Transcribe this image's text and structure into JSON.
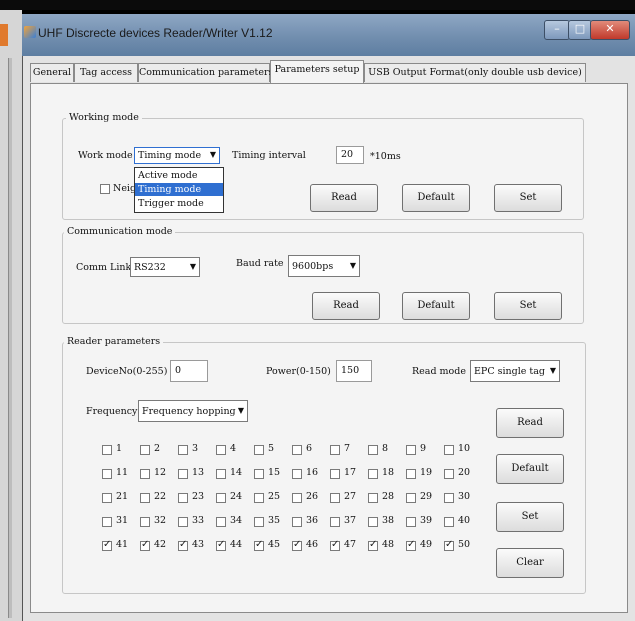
{
  "window": {
    "title": "UHF Discrecte devices Reader/Writer V1.12",
    "controls": {
      "minimize": "–",
      "maximize": "□",
      "close": "✕"
    }
  },
  "tabs": [
    {
      "label": "General",
      "active": false
    },
    {
      "label": "Tag access",
      "active": false
    },
    {
      "label": "Communication parameters",
      "active": false
    },
    {
      "label": "Parameters setup",
      "active": true
    },
    {
      "label": "USB Output Format(only double usb device)",
      "active": false
    }
  ],
  "working_mode": {
    "title": "Working mode",
    "work_mode_label": "Work mode",
    "work_mode_value": "Timing mode",
    "options": [
      "Active mode",
      "Timing mode",
      "Trigger mode"
    ],
    "selected_option_index": 1,
    "timing_interval_label": "Timing interval",
    "timing_interval_value": "20",
    "timing_unit": "*10ms",
    "neighbor_checkbox_visible_label": "Neig",
    "neighbor_checkbox_suffix": ")",
    "buttons": {
      "read": "Read",
      "default": "Default",
      "set": "Set"
    }
  },
  "communication_mode": {
    "title": "Communication mode",
    "comm_link_label": "Comm Link",
    "comm_link_value": "RS232",
    "baud_rate_label": "Baud rate",
    "baud_rate_value": "9600bps",
    "buttons": {
      "read": "Read",
      "default": "Default",
      "set": "Set"
    }
  },
  "reader_parameters": {
    "title": "Reader parameters",
    "device_no_label": "DeviceNo(0-255)",
    "device_no_value": "0",
    "power_label": "Power(0-150)",
    "power_value": "150",
    "read_mode_label": "Read mode",
    "read_mode_value": "EPC single tag",
    "frequency_label": "Frequency",
    "frequency_value": "Frequency hopping",
    "buttons": {
      "read": "Read",
      "default": "Default",
      "set": "Set",
      "clear": "Clear"
    },
    "frequencies": [
      {
        "label": "1",
        "checked": false
      },
      {
        "label": "2",
        "checked": false
      },
      {
        "label": "3",
        "checked": false
      },
      {
        "label": "4",
        "checked": false
      },
      {
        "label": "5",
        "checked": false
      },
      {
        "label": "6",
        "checked": false
      },
      {
        "label": "7",
        "checked": false
      },
      {
        "label": "8",
        "checked": false
      },
      {
        "label": "9",
        "checked": false
      },
      {
        "label": "10",
        "checked": false
      },
      {
        "label": "11",
        "checked": false
      },
      {
        "label": "12",
        "checked": false
      },
      {
        "label": "13",
        "checked": false
      },
      {
        "label": "14",
        "checked": false
      },
      {
        "label": "15",
        "checked": false
      },
      {
        "label": "16",
        "checked": false
      },
      {
        "label": "17",
        "checked": false
      },
      {
        "label": "18",
        "checked": false
      },
      {
        "label": "19",
        "checked": false
      },
      {
        "label": "20",
        "checked": false
      },
      {
        "label": "21",
        "checked": false
      },
      {
        "label": "22",
        "checked": false
      },
      {
        "label": "23",
        "checked": false
      },
      {
        "label": "24",
        "checked": false
      },
      {
        "label": "25",
        "checked": false
      },
      {
        "label": "26",
        "checked": false
      },
      {
        "label": "27",
        "checked": false
      },
      {
        "label": "28",
        "checked": false
      },
      {
        "label": "29",
        "checked": false
      },
      {
        "label": "30",
        "checked": false
      },
      {
        "label": "31",
        "checked": false
      },
      {
        "label": "32",
        "checked": false
      },
      {
        "label": "33",
        "checked": false
      },
      {
        "label": "34",
        "checked": false
      },
      {
        "label": "35",
        "checked": false
      },
      {
        "label": "36",
        "checked": false
      },
      {
        "label": "37",
        "checked": false
      },
      {
        "label": "38",
        "checked": false
      },
      {
        "label": "39",
        "checked": false
      },
      {
        "label": "40",
        "checked": false
      },
      {
        "label": "41",
        "checked": true
      },
      {
        "label": "42",
        "checked": true
      },
      {
        "label": "43",
        "checked": true
      },
      {
        "label": "44",
        "checked": true
      },
      {
        "label": "45",
        "checked": true
      },
      {
        "label": "46",
        "checked": true
      },
      {
        "label": "47",
        "checked": true
      },
      {
        "label": "48",
        "checked": true
      },
      {
        "label": "49",
        "checked": true
      },
      {
        "label": "50",
        "checked": true
      }
    ]
  }
}
